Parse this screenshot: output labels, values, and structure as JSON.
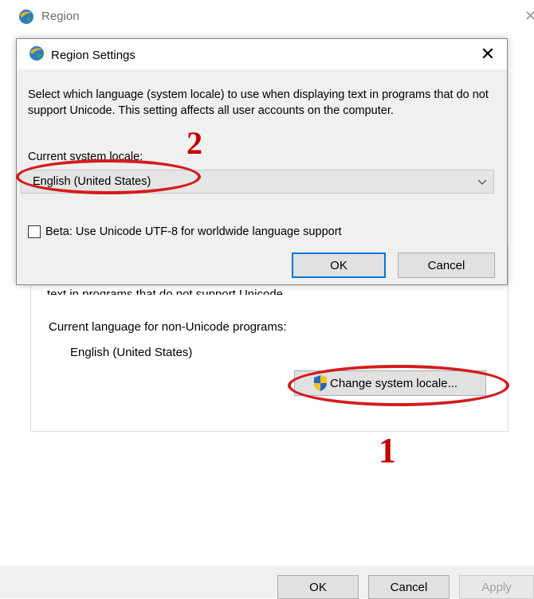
{
  "region_window": {
    "title": "Region",
    "close_glyph": "✕",
    "obscured_text": "text in programs that do not support Unicode.",
    "current_language_label": "Current language for non-Unicode programs:",
    "current_language_value": "English (United States)",
    "change_locale_button": "Change system locale...",
    "buttons": {
      "ok": "OK",
      "cancel": "Cancel",
      "apply": "Apply"
    }
  },
  "dialog": {
    "title": "Region Settings",
    "close_glyph": "✕",
    "description": "Select which language (system locale) to use when displaying text in programs that do not support Unicode. This setting affects all user accounts on the computer.",
    "locale_label": "Current system locale:",
    "locale_value": "English (United States)",
    "beta_label": "Beta: Use Unicode UTF-8 for worldwide language support",
    "beta_checked": false,
    "buttons": {
      "ok": "OK",
      "cancel": "Cancel"
    }
  },
  "annotations": {
    "step_1": "1",
    "step_2": "2",
    "color": "#d41c1c"
  },
  "icons": {
    "app": "globe-icon",
    "uac": "shield-icon",
    "dropdown": "chevron-down-icon"
  }
}
